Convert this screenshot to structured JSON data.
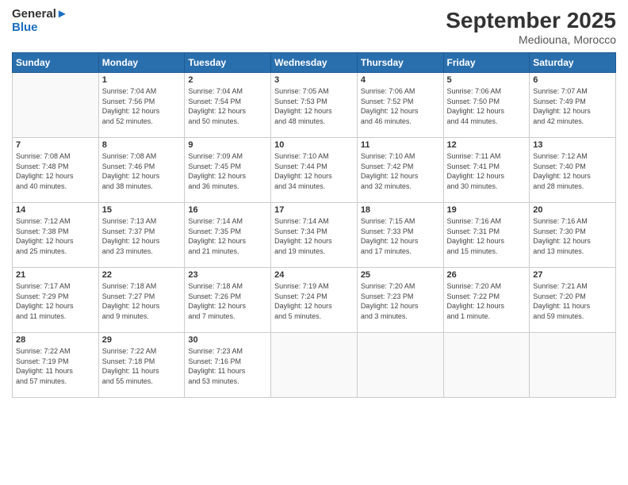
{
  "header": {
    "logo_line1": "General",
    "logo_line2": "Blue",
    "month_title": "September 2025",
    "location": "Mediouna, Morocco"
  },
  "days_of_week": [
    "Sunday",
    "Monday",
    "Tuesday",
    "Wednesday",
    "Thursday",
    "Friday",
    "Saturday"
  ],
  "weeks": [
    [
      {
        "day": "",
        "info": ""
      },
      {
        "day": "1",
        "info": "Sunrise: 7:04 AM\nSunset: 7:56 PM\nDaylight: 12 hours\nand 52 minutes."
      },
      {
        "day": "2",
        "info": "Sunrise: 7:04 AM\nSunset: 7:54 PM\nDaylight: 12 hours\nand 50 minutes."
      },
      {
        "day": "3",
        "info": "Sunrise: 7:05 AM\nSunset: 7:53 PM\nDaylight: 12 hours\nand 48 minutes."
      },
      {
        "day": "4",
        "info": "Sunrise: 7:06 AM\nSunset: 7:52 PM\nDaylight: 12 hours\nand 46 minutes."
      },
      {
        "day": "5",
        "info": "Sunrise: 7:06 AM\nSunset: 7:50 PM\nDaylight: 12 hours\nand 44 minutes."
      },
      {
        "day": "6",
        "info": "Sunrise: 7:07 AM\nSunset: 7:49 PM\nDaylight: 12 hours\nand 42 minutes."
      }
    ],
    [
      {
        "day": "7",
        "info": "Sunrise: 7:08 AM\nSunset: 7:48 PM\nDaylight: 12 hours\nand 40 minutes."
      },
      {
        "day": "8",
        "info": "Sunrise: 7:08 AM\nSunset: 7:46 PM\nDaylight: 12 hours\nand 38 minutes."
      },
      {
        "day": "9",
        "info": "Sunrise: 7:09 AM\nSunset: 7:45 PM\nDaylight: 12 hours\nand 36 minutes."
      },
      {
        "day": "10",
        "info": "Sunrise: 7:10 AM\nSunset: 7:44 PM\nDaylight: 12 hours\nand 34 minutes."
      },
      {
        "day": "11",
        "info": "Sunrise: 7:10 AM\nSunset: 7:42 PM\nDaylight: 12 hours\nand 32 minutes."
      },
      {
        "day": "12",
        "info": "Sunrise: 7:11 AM\nSunset: 7:41 PM\nDaylight: 12 hours\nand 30 minutes."
      },
      {
        "day": "13",
        "info": "Sunrise: 7:12 AM\nSunset: 7:40 PM\nDaylight: 12 hours\nand 28 minutes."
      }
    ],
    [
      {
        "day": "14",
        "info": "Sunrise: 7:12 AM\nSunset: 7:38 PM\nDaylight: 12 hours\nand 25 minutes."
      },
      {
        "day": "15",
        "info": "Sunrise: 7:13 AM\nSunset: 7:37 PM\nDaylight: 12 hours\nand 23 minutes."
      },
      {
        "day": "16",
        "info": "Sunrise: 7:14 AM\nSunset: 7:35 PM\nDaylight: 12 hours\nand 21 minutes."
      },
      {
        "day": "17",
        "info": "Sunrise: 7:14 AM\nSunset: 7:34 PM\nDaylight: 12 hours\nand 19 minutes."
      },
      {
        "day": "18",
        "info": "Sunrise: 7:15 AM\nSunset: 7:33 PM\nDaylight: 12 hours\nand 17 minutes."
      },
      {
        "day": "19",
        "info": "Sunrise: 7:16 AM\nSunset: 7:31 PM\nDaylight: 12 hours\nand 15 minutes."
      },
      {
        "day": "20",
        "info": "Sunrise: 7:16 AM\nSunset: 7:30 PM\nDaylight: 12 hours\nand 13 minutes."
      }
    ],
    [
      {
        "day": "21",
        "info": "Sunrise: 7:17 AM\nSunset: 7:29 PM\nDaylight: 12 hours\nand 11 minutes."
      },
      {
        "day": "22",
        "info": "Sunrise: 7:18 AM\nSunset: 7:27 PM\nDaylight: 12 hours\nand 9 minutes."
      },
      {
        "day": "23",
        "info": "Sunrise: 7:18 AM\nSunset: 7:26 PM\nDaylight: 12 hours\nand 7 minutes."
      },
      {
        "day": "24",
        "info": "Sunrise: 7:19 AM\nSunset: 7:24 PM\nDaylight: 12 hours\nand 5 minutes."
      },
      {
        "day": "25",
        "info": "Sunrise: 7:20 AM\nSunset: 7:23 PM\nDaylight: 12 hours\nand 3 minutes."
      },
      {
        "day": "26",
        "info": "Sunrise: 7:20 AM\nSunset: 7:22 PM\nDaylight: 12 hours\nand 1 minute."
      },
      {
        "day": "27",
        "info": "Sunrise: 7:21 AM\nSunset: 7:20 PM\nDaylight: 11 hours\nand 59 minutes."
      }
    ],
    [
      {
        "day": "28",
        "info": "Sunrise: 7:22 AM\nSunset: 7:19 PM\nDaylight: 11 hours\nand 57 minutes."
      },
      {
        "day": "29",
        "info": "Sunrise: 7:22 AM\nSunset: 7:18 PM\nDaylight: 11 hours\nand 55 minutes."
      },
      {
        "day": "30",
        "info": "Sunrise: 7:23 AM\nSunset: 7:16 PM\nDaylight: 11 hours\nand 53 minutes."
      },
      {
        "day": "",
        "info": ""
      },
      {
        "day": "",
        "info": ""
      },
      {
        "day": "",
        "info": ""
      },
      {
        "day": "",
        "info": ""
      }
    ]
  ]
}
